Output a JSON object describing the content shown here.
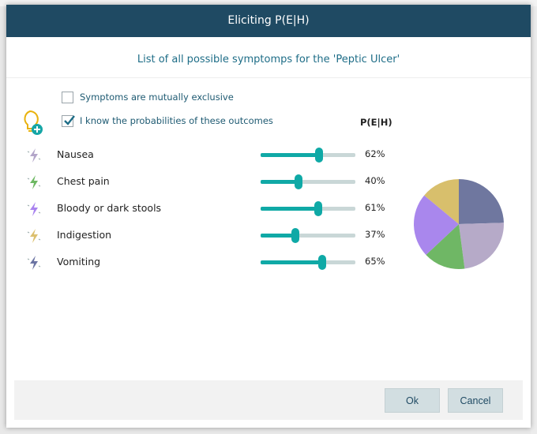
{
  "dialog": {
    "title": "Eliciting P(E|H)",
    "subtitle": "List of all possible symptomps for the 'Peptic Ulcer'"
  },
  "options": {
    "mutually_exclusive": {
      "label": "Symptoms are mutually exclusive",
      "checked": false
    },
    "know_probabilities": {
      "label": "I know the probabilities of these outcomes",
      "checked": true
    }
  },
  "column_header": "P(E|H)",
  "symptoms": [
    {
      "name": "Nausea",
      "probability": 0.62,
      "percent_label": "62%",
      "icon": "lightning-icon",
      "color": "#b3a6c9"
    },
    {
      "name": "Chest pain",
      "probability": 0.4,
      "percent_label": "40%",
      "icon": "lightning-icon",
      "color": "#6db862"
    },
    {
      "name": "Bloody or dark stools",
      "probability": 0.61,
      "percent_label": "61%",
      "icon": "lightning-icon",
      "color": "#a983ef"
    },
    {
      "name": "Indigestion",
      "probability": 0.37,
      "percent_label": "37%",
      "icon": "lightning-icon",
      "color": "#dcc06f"
    },
    {
      "name": "Vomiting",
      "probability": 0.65,
      "percent_label": "65%",
      "icon": "lightning-icon",
      "color": "#6b74a3"
    }
  ],
  "chart_data": {
    "type": "pie",
    "categories": [
      "Vomiting",
      "Nausea",
      "Chest pain",
      "Bloody or dark stools",
      "Indigestion"
    ],
    "values": [
      0.65,
      0.62,
      0.4,
      0.61,
      0.37
    ],
    "colors": [
      "#6f779f",
      "#b6aac8",
      "#6fb765",
      "#a987ed",
      "#d8bf6c"
    ]
  },
  "buttons": {
    "ok": "Ok",
    "cancel": "Cancel"
  },
  "colors": {
    "titlebar": "#1f4a63",
    "accent": "#10a9a6",
    "subtitle": "#1e6d87"
  }
}
